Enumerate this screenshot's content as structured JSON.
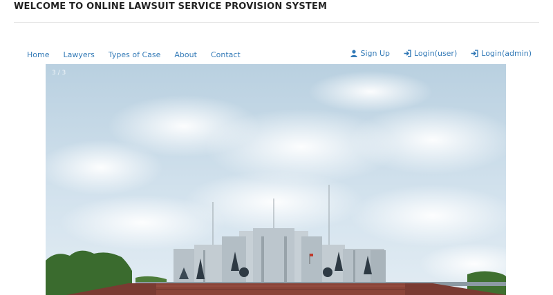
{
  "header": {
    "title": "WELCOME TO ONLINE LAWSUIT SERVICE PROVISION SYSTEM"
  },
  "nav": {
    "left": [
      {
        "label": "Home"
      },
      {
        "label": "Lawyers"
      },
      {
        "label": "Types of Case"
      },
      {
        "label": "About"
      },
      {
        "label": "Contact"
      }
    ],
    "right": [
      {
        "label": "Sign Up",
        "icon": "user-icon"
      },
      {
        "label": "Login(user)",
        "icon": "login-icon"
      },
      {
        "label": "Login(admin)",
        "icon": "login-icon"
      }
    ]
  },
  "carousel": {
    "counter": "3 / 3"
  },
  "colors": {
    "link": "#337ab7",
    "title": "#222222",
    "sky": "#c9dbe8",
    "building": "#b9c4cc",
    "brick": "#7a3b32",
    "trees": "#3a6b2e"
  }
}
